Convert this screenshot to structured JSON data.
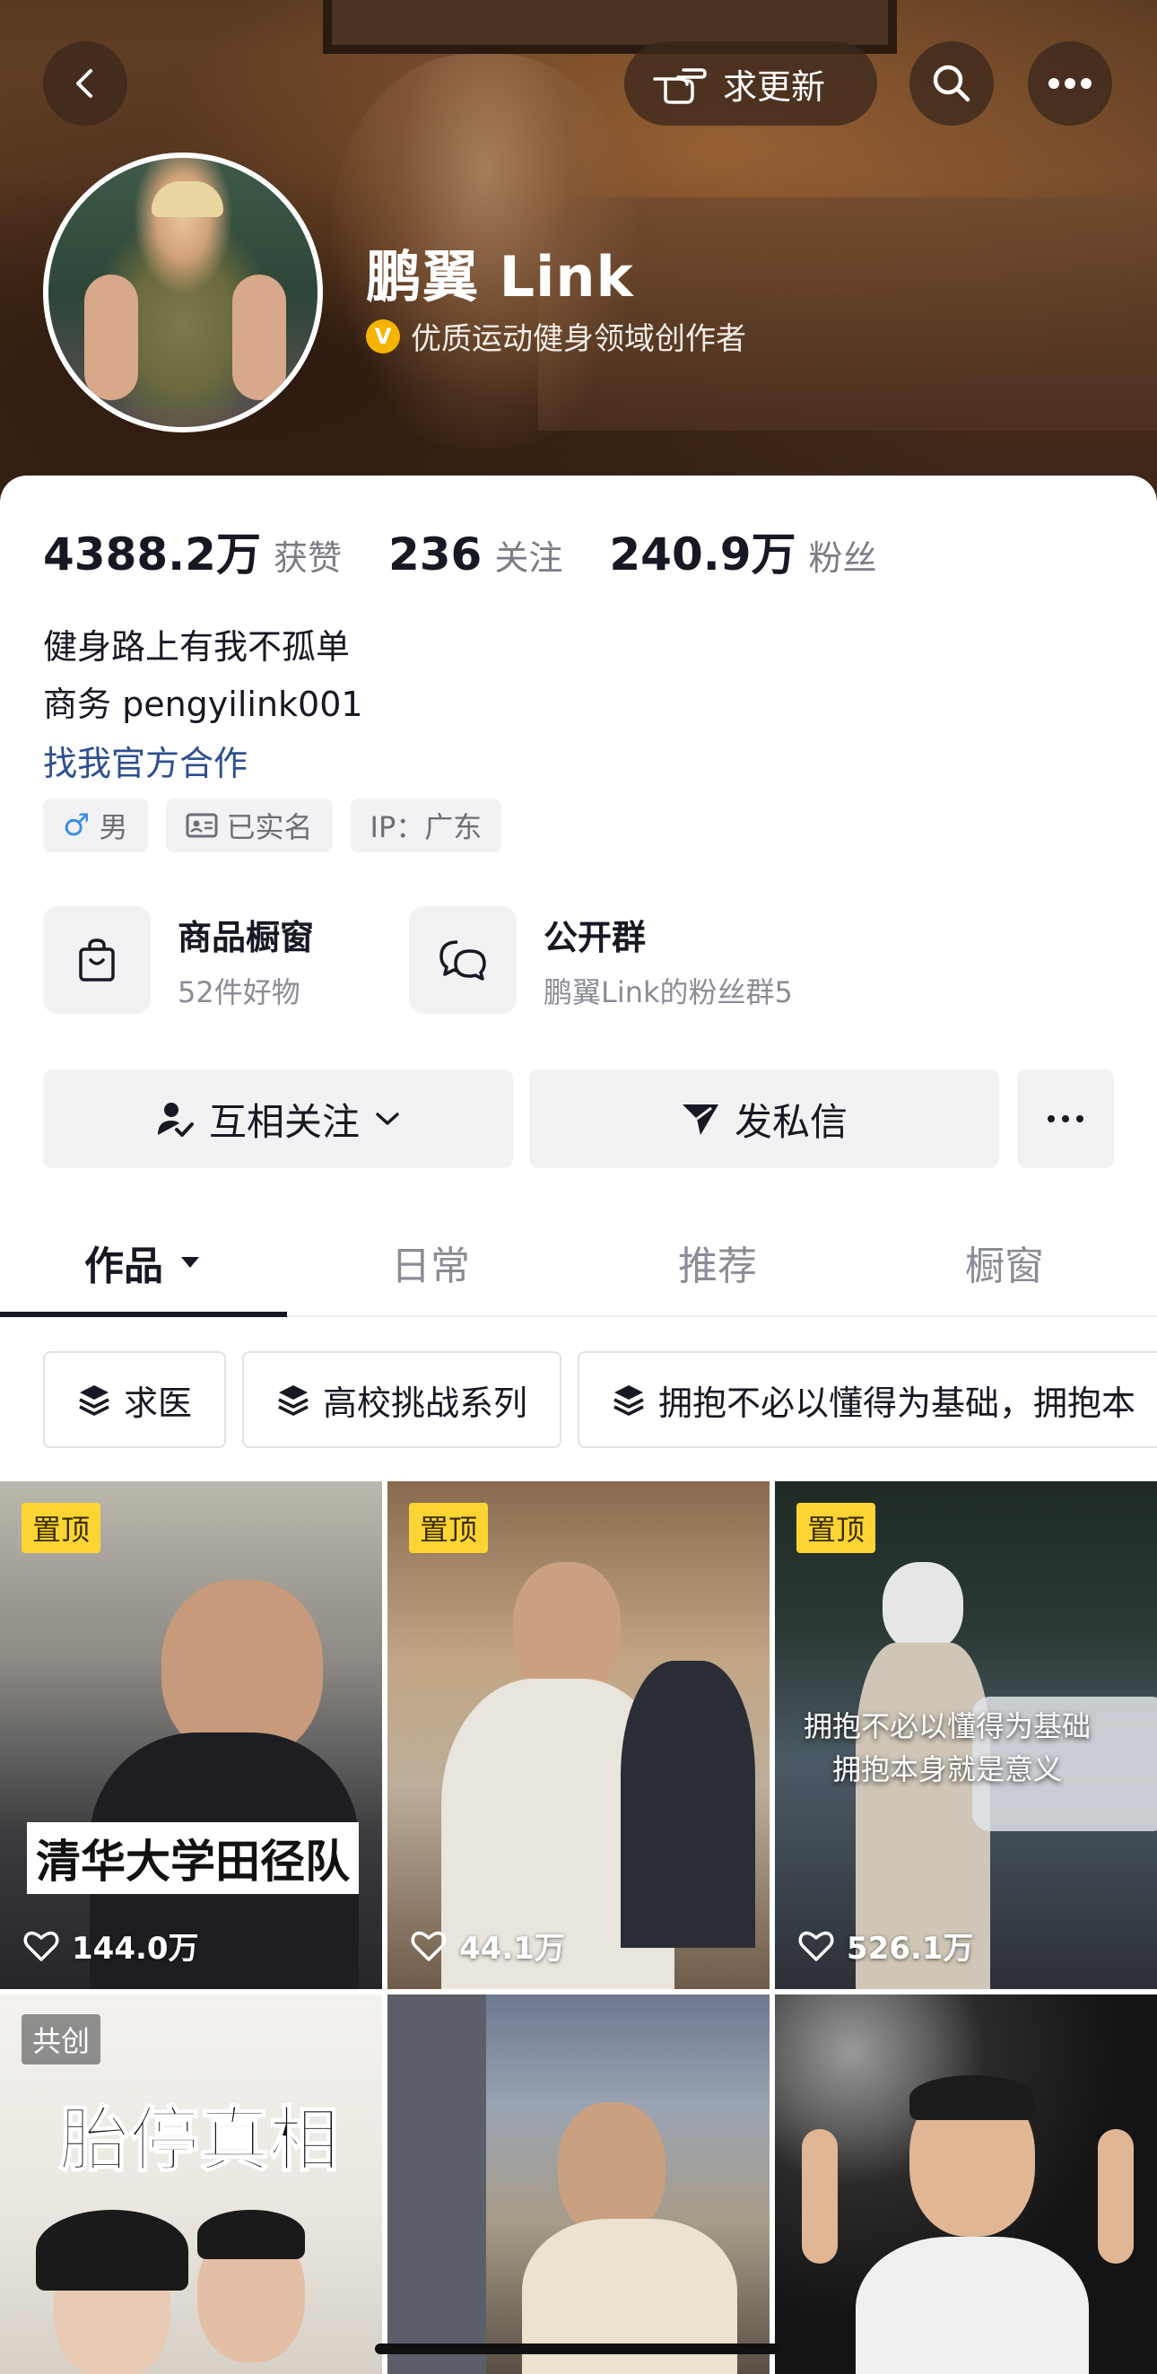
{
  "header": {
    "request_update_label": "求更新",
    "nickname": "鹏翼 Link",
    "verification": "优质运动健身领域创作者",
    "verify_badge": "V"
  },
  "stats": [
    {
      "value": "4388.2万",
      "label": "获赞"
    },
    {
      "value": "236",
      "label": "关注"
    },
    {
      "value": "240.9万",
      "label": "粉丝"
    }
  ],
  "bio": {
    "line1": "健身路上有我不孤单",
    "line2": "商务 pengyilink001",
    "link": "找我官方合作"
  },
  "tags": {
    "gender_symbol": "♂",
    "gender": "男",
    "realname": "已实名",
    "ip": "IP：广东"
  },
  "features": {
    "shop_title": "商品橱窗",
    "shop_sub": "52件好物",
    "group_title": "公开群",
    "group_sub": "鹏翼Link的粉丝群5"
  },
  "actions": {
    "follow": "互相关注",
    "message": "发私信"
  },
  "tabs": [
    "作品",
    "日常",
    "推荐",
    "橱窗"
  ],
  "chips": [
    "求医",
    "高校挑战系列",
    "拥抱不必以懂得为基础，拥抱本"
  ],
  "videos": [
    {
      "badge": "置顶",
      "likes": "144.0万",
      "overlay": "清华大学田径队"
    },
    {
      "badge": "置顶",
      "likes": "44.1万"
    },
    {
      "badge": "置顶",
      "likes": "526.1万",
      "overlay_line1": "拥抱不必以懂得为基础",
      "overlay_line2": "拥抱本身就是意义"
    },
    {
      "badge": "共创",
      "overlay": "胎停真相"
    },
    {},
    {}
  ],
  "colors": {
    "pin_badge": "#fcd535",
    "link": "#2d4f8f",
    "verify_badge": "#f4b400"
  }
}
